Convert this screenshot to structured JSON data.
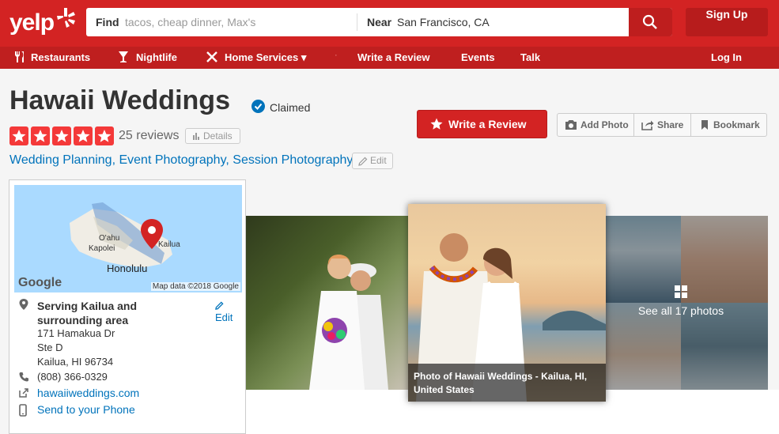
{
  "header": {
    "logo_text": "yelp",
    "search_find_label": "Find",
    "search_find_placeholder": "tacos, cheap dinner, Max's",
    "search_near_label": "Near",
    "search_near_value": "San Francisco, CA",
    "signup_label": "Sign Up"
  },
  "nav": {
    "items": [
      "Restaurants",
      "Nightlife",
      "Home Services ▾",
      "Write a Review",
      "Events",
      "Talk"
    ],
    "separator": "·",
    "login_label": "Log In"
  },
  "business": {
    "name": "Hawaii Weddings",
    "claimed_label": "Claimed",
    "rating": 5,
    "rating_max": 5,
    "reviews_text": "25 reviews",
    "details_label": "Details",
    "categories": [
      "Wedding Planning",
      "Event Photography",
      "Session Photography"
    ],
    "category_separator": ",",
    "edit_label": "Edit"
  },
  "actions": {
    "write_review_label": "Write a Review",
    "add_photo_label": "Add Photo",
    "share_label": "Share",
    "bookmark_label": "Bookmark"
  },
  "map": {
    "label_oahu": "O'ahu",
    "label_kapolei": "Kapolei",
    "label_honolulu": "Honolulu",
    "label_kailua": "Kailua",
    "google_label": "Google",
    "credit": "Map data ©2018 Google"
  },
  "location": {
    "serving": "Serving Kailua and surrounding area",
    "edit_label": "Edit",
    "address_line1": "171 Hamakua Dr",
    "address_line2": "Ste D",
    "address_line3": "Kailua, HI 96734",
    "phone": "(808) 366-0329",
    "website": "hawaiiweddings.com",
    "send_to_phone": "Send to your Phone"
  },
  "photos": {
    "caption": "Photo of Hawaii Weddings - Kailua, HI, United States",
    "see_all": "See all 17 photos"
  },
  "colors": {
    "brand_red": "#d32323",
    "nav_red": "#bf1f1f",
    "link_blue": "#0073bb",
    "star_red": "#f43939",
    "claimed_blue": "#0073bb"
  }
}
